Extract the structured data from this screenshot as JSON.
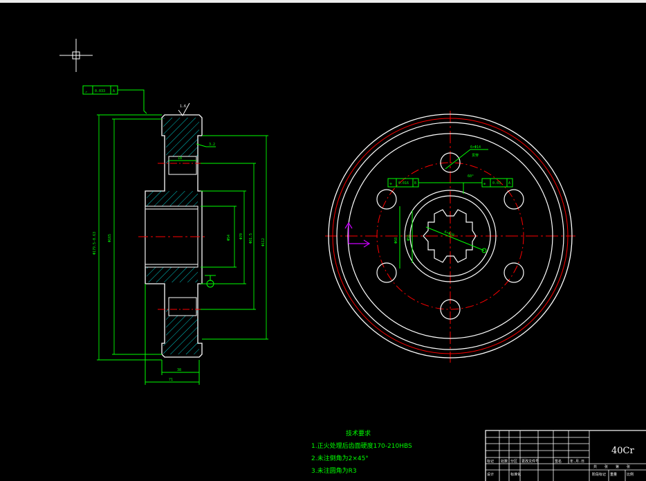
{
  "app": {
    "window_bar_color": "#ececec",
    "canvas_color": "#000000"
  },
  "colors": {
    "outline": "#ffffff",
    "dimension": "#00ff00",
    "centerline": "#ff0000",
    "hatch": "#00ffff",
    "ucs": "#cc00ff",
    "crosshair": "#ffffff"
  },
  "drawing": {
    "side_view": {
      "tolerance_frame_top": {
        "symbol": "↗",
        "value": "0.033",
        "datum": "A"
      },
      "roughness_top": "1.6",
      "dims": {
        "outer_dia": "Φ179.5-0.63",
        "root_dia": "Φ165",
        "hub_dia": "Φ112",
        "bolt_dia": "Φ81.5",
        "bore_dia": "Φ70",
        "bore_small": "Φ54",
        "web_thickness": "18",
        "face_roughness": "3.2",
        "face_width": "38",
        "hub_length": "71"
      }
    },
    "front_view": {
      "callout_holes": "6×Φ14",
      "callout_depth": "贯穿",
      "frame_left": {
        "symbol": "⌯",
        "value": "0.016",
        "datum": "B"
      },
      "frame_right": {
        "symbol": "⊕",
        "value": "0.03",
        "datum": "A"
      },
      "spline_note": "6×Φ20",
      "spline_angle": "60°",
      "inner_dia": "Φ68",
      "inner_dia_b": "Φ56"
    },
    "notes": {
      "title": "技术要求",
      "items": [
        "1.正火处理后齿面硬度170-210HBS",
        "2.未注倒角为2×45°",
        "3.未注圆角为R3"
      ]
    },
    "title_block": {
      "material": "40Cr",
      "row_labels": [
        "标记",
        "处数",
        "分区",
        "更改文件号",
        "签名",
        "年.月.日"
      ],
      "bottom_labels": [
        "设计",
        "标准化",
        "阶段标记",
        "重量",
        "比例"
      ],
      "sheet_labels": [
        "共",
        "张",
        "第",
        "张"
      ]
    }
  }
}
